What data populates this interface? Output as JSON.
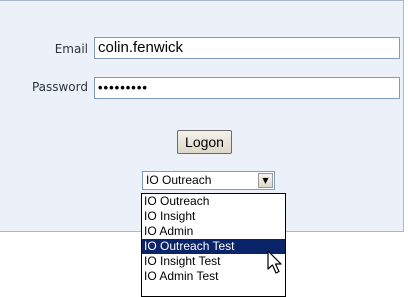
{
  "login": {
    "email_label": "Email",
    "email_value": "colin.fenwick",
    "password_label": "Password",
    "password_value": "•••••••••",
    "logon_label": "Logon"
  },
  "app_select": {
    "selected": "IO Outreach",
    "options": [
      {
        "label": "IO Outreach"
      },
      {
        "label": "IO Insight"
      },
      {
        "label": "IO Admin"
      },
      {
        "label": "IO Outreach Test",
        "highlighted": true
      },
      {
        "label": "IO Insight Test"
      },
      {
        "label": "IO Admin Test"
      }
    ]
  },
  "colors": {
    "panel_bg": "#ecf1f9",
    "highlight": "#0a246a",
    "field_border": "#7f9db9"
  }
}
